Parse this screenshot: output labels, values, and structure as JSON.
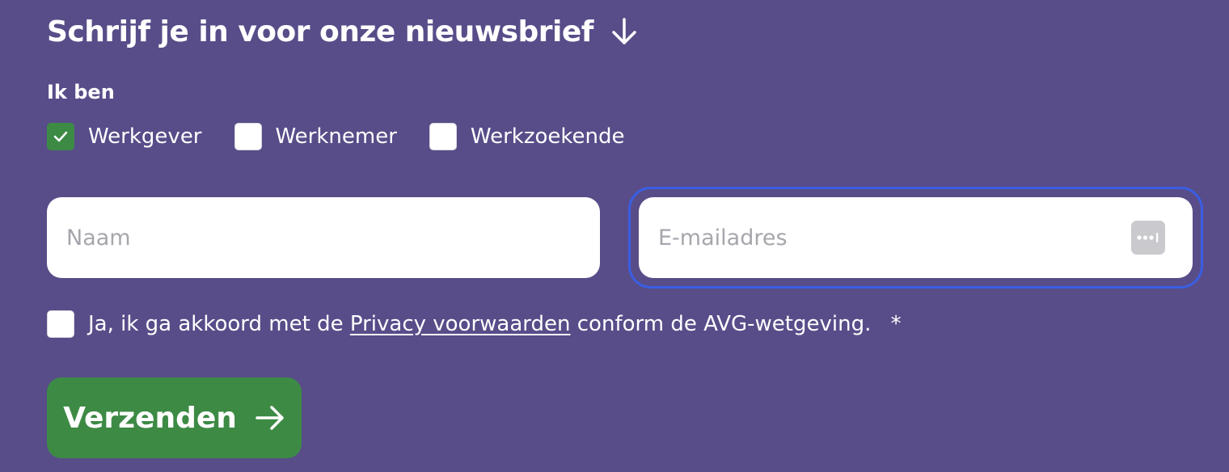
{
  "newsletter": {
    "title": "Schrijf je in voor onze nieuwsbrief",
    "subtitle": "Ik ben",
    "roles": [
      {
        "label": "Werkgever",
        "checked": true
      },
      {
        "label": "Werknemer",
        "checked": false
      },
      {
        "label": "Werkzoekende",
        "checked": false
      }
    ],
    "name_field": {
      "value": "",
      "placeholder": "Naam"
    },
    "email_field": {
      "value": "",
      "placeholder": "E-mailadres",
      "focused": true
    },
    "consent": {
      "checked": false,
      "text_before": "Ja, ik ga akkoord met de",
      "link_text": "Privacy voorwaarden",
      "text_after": "conform de AVG-wetgeving.",
      "required_mark": "*"
    },
    "submit_label": "Verzenden"
  },
  "icons": {
    "title_icon": "arrow-down-icon",
    "submit_icon": "arrow-right-icon",
    "checkmark_icon": "checkmark-icon",
    "autofill_icon": "password-autofill-icon"
  },
  "colors": {
    "background": "#584d89",
    "accent_green": "#3d8a45",
    "focus_ring": "#3a5ee3",
    "field_background": "#ffffff",
    "placeholder": "#a6a6ad"
  }
}
